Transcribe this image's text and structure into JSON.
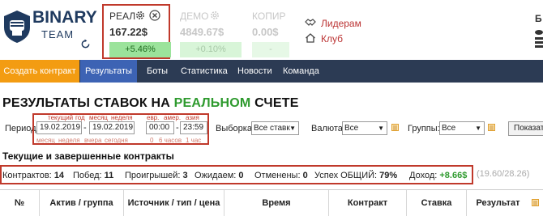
{
  "brand": {
    "line1": "BINARY",
    "line2": "TEAM"
  },
  "accounts": {
    "real": {
      "name": "РЕАЛ",
      "value": "167.22$",
      "pct": "+5.46%"
    },
    "demo": {
      "name": "ДЕМО",
      "value": "4849.67$",
      "pct": "+0.10%"
    },
    "copy": {
      "name": "КОПИР",
      "value": "0.00$",
      "pct": "-"
    }
  },
  "header_links": {
    "leaders": "Лидерам",
    "club": "Клуб"
  },
  "header_right": {
    "letter": "Б"
  },
  "nav": {
    "create": "Создать контракт",
    "results": "Результаты",
    "bots": "Боты",
    "stats": "Статистика",
    "news": "Новости",
    "team": "Команда"
  },
  "title": {
    "part1": "РЕЗУЛЬТАТЫ СТАВОК НА ",
    "part2": "РЕАЛЬНОМ",
    "part3": " СЧЕТЕ"
  },
  "filters": {
    "period_label": "Период",
    "shortcuts_top": {
      "current": "текущий",
      "year": "год",
      "month": "месяц",
      "week": "неделя"
    },
    "shortcuts_bottom": {
      "month": "месяц",
      "week": "неделя",
      "yesterday": "вчера",
      "today": "сегодня"
    },
    "date_from": "19.02.2019",
    "date_to": "19.02.2019",
    "sessions": {
      "eur": "евр.",
      "amer": "амер.",
      "asia": "азия"
    },
    "time_from": "00:00",
    "time_to": "23:59",
    "time_shortcuts": {
      "zero": "0",
      "six": "6 часов",
      "one": "1 час"
    },
    "sample_label": "Выборка:",
    "sample_value": "Все ставк",
    "currency_label": "Валюта:",
    "currency_value": "Все",
    "groups_label": "Группы:",
    "groups_value": "Все",
    "show_button": "Показат"
  },
  "section_title": "Текущие и завершенные контракты",
  "stats": {
    "contracts_label": "Контрактов:",
    "contracts": "14",
    "wins_label": "Побед:",
    "wins": "11",
    "losses_label": "Проигрышей:",
    "losses": "3",
    "pending_label": "Ожидаем:",
    "pending": "0",
    "cancelled_label": "Отменены:",
    "cancelled": "0",
    "success_label": "Успех ОБЩИЙ:",
    "success": "79%",
    "income_label": "Доход:",
    "income": "+8.66$",
    "extra": "(19.60/28.26)"
  },
  "table_headers": [
    "№",
    "Актив / группа",
    "Источник / тип / цена",
    "Время",
    "Контракт",
    "Ставка",
    "Результат"
  ],
  "colors": {
    "nav_bg": "#2c3b54",
    "create_bg": "#f39c12",
    "active_tab": "#3d63b4",
    "highlight": "#c0392b",
    "green": "#2e9a2e"
  }
}
